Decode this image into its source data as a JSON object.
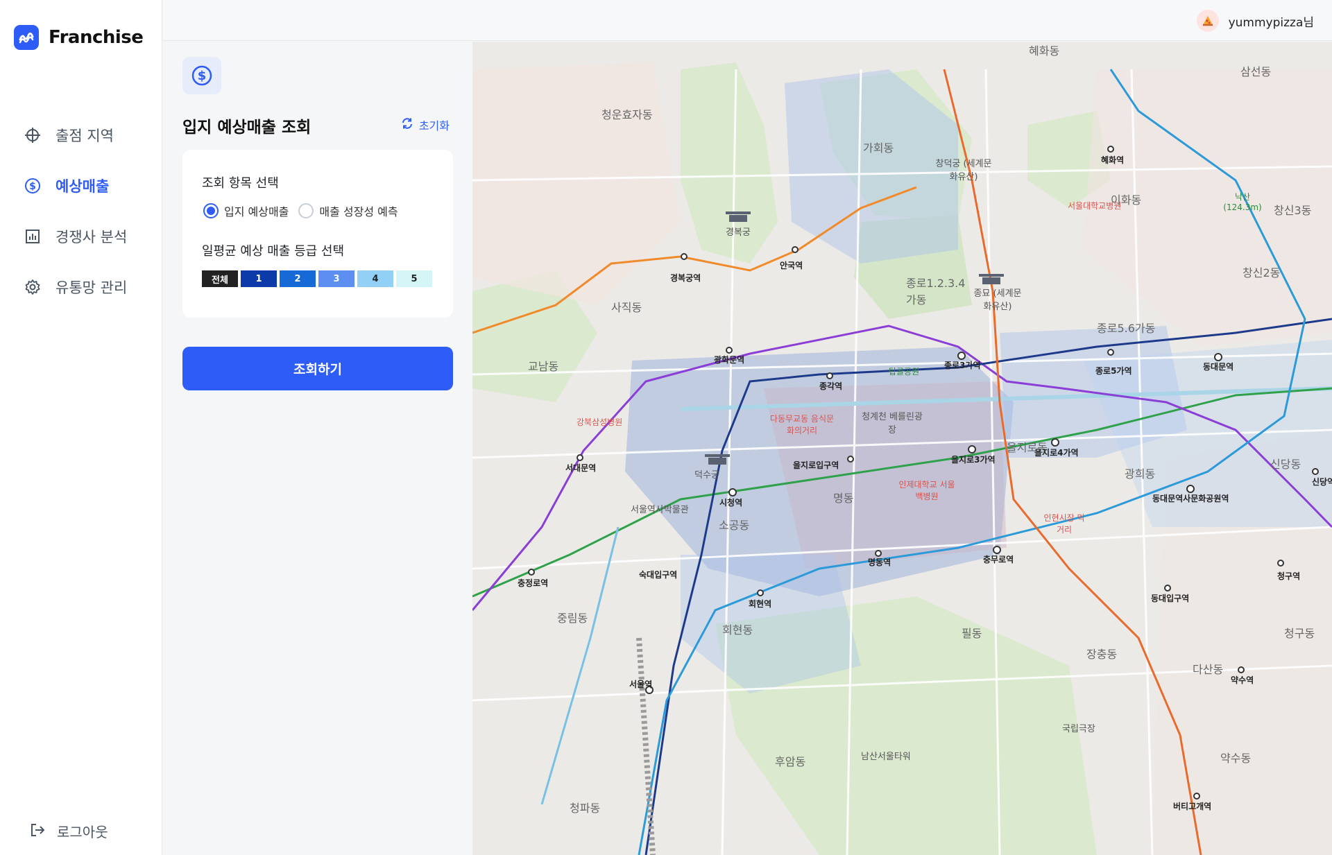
{
  "brand": {
    "name": "Franchise"
  },
  "nav": [
    {
      "label": "출점 지역",
      "icon": "crosshair-icon"
    },
    {
      "label": "예상매출",
      "icon": "dollar-circle-icon",
      "active": true
    },
    {
      "label": "경쟁사 분석",
      "icon": "bar-chart-icon"
    },
    {
      "label": "유통망 관리",
      "icon": "gear-icon"
    }
  ],
  "logout": {
    "label": "로그아웃"
  },
  "header": {
    "user_name": "yummypizza님"
  },
  "panel": {
    "title": "입지 예상매출 조회",
    "reset_label": "초기화",
    "section1_label": "조회 항목 선택",
    "options": [
      "입지 예상매출",
      "매출 성장성 예측"
    ],
    "selected_option": "입지 예상매출",
    "section2_label": "일평균 예상 매출 등급 선택",
    "grades": [
      {
        "label": "전체",
        "color": "#222222",
        "text_color": "#ffffff"
      },
      {
        "label": "1",
        "color": "#0c3aa8",
        "text_color": "#ffffff"
      },
      {
        "label": "2",
        "color": "#1769d6",
        "text_color": "#ffffff"
      },
      {
        "label": "3",
        "color": "#5c8ff0",
        "text_color": "#ffffff"
      },
      {
        "label": "4",
        "color": "#93d0f5",
        "text_color": "#1f2328"
      },
      {
        "label": "5",
        "color": "#d4f4f6",
        "text_color": "#1f2328"
      }
    ],
    "submit_label": "조회하기"
  },
  "map": {
    "districts": [
      "청운효자동",
      "가회동",
      "혜화동",
      "삼선동",
      "이화동",
      "창신3동",
      "창신2동",
      "사직동",
      "교남동",
      "종로1.2.3.4가동",
      "종로5.6가동",
      "을지로동",
      "광희동",
      "신당동",
      "명동",
      "소공동",
      "회현동",
      "필동",
      "장충동",
      "다산동",
      "중림동",
      "후암동",
      "청파동",
      "약수동",
      "청구동"
    ],
    "stations": [
      "경복궁역",
      "안국역",
      "혜화역",
      "광화문역",
      "종각역",
      "종로3가역",
      "종로5가역",
      "동대문역",
      "시청역",
      "을지로입구역",
      "을지로3가역",
      "을지로4가역",
      "동대문역사문화공원역",
      "서대문역",
      "충정로역",
      "서울역",
      "회현역",
      "명동역",
      "충무로역",
      "동대입구역",
      "약수역",
      "버티고개역",
      "청구역",
      "숙대입구역",
      "신당역"
    ],
    "landmarks": [
      "경복궁",
      "덕수궁",
      "종묘 (세계문화유산)",
      "창덕궁 (세계문화유산)",
      "남산서울타워",
      "국립극장",
      "낙산 (124.3m)",
      "청계천 베를린광장",
      "다동무교동 음식문화의거리",
      "인제대학교 서울백병원",
      "강북삼성병원",
      "서울대학교병원",
      "인현시장 먹거리",
      "탑골공원",
      "서울역사박물관"
    ]
  }
}
